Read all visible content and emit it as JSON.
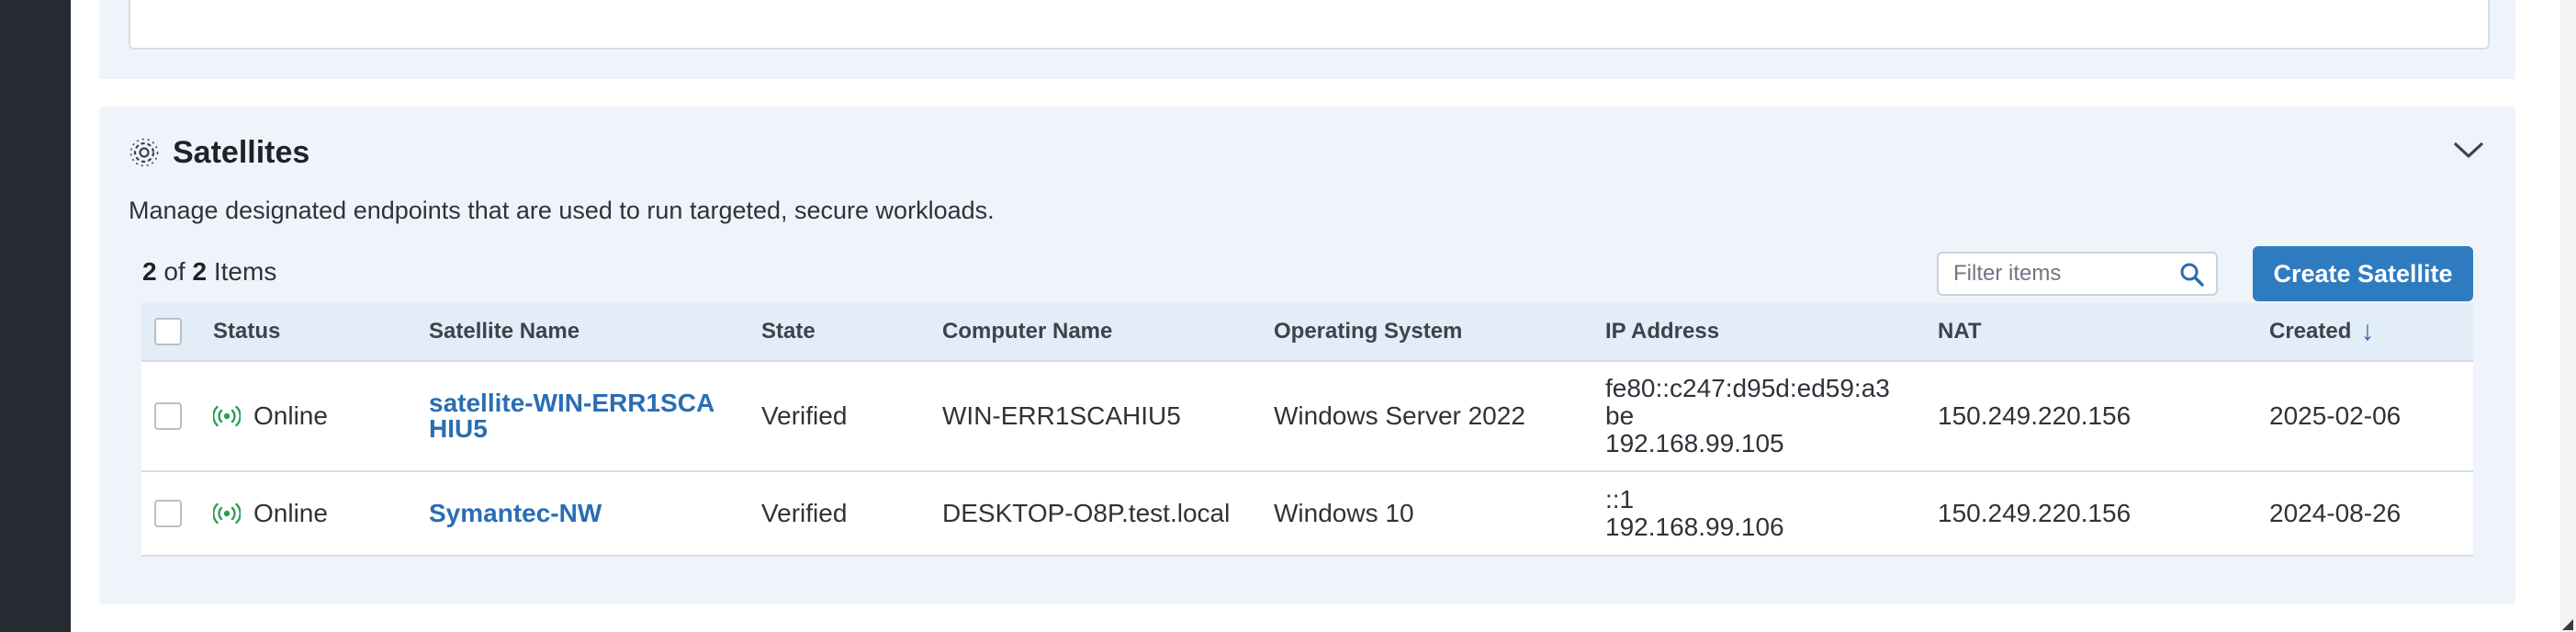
{
  "panel": {
    "title": "Satellites",
    "description": "Manage designated endpoints that are used to run targeted, secure workloads."
  },
  "toolbar": {
    "count_shown": "2",
    "count_of": "of",
    "count_total": "2",
    "count_unit": "Items",
    "filter_placeholder": "Filter items",
    "create_label": "Create Satellite"
  },
  "table": {
    "headers": {
      "status": "Status",
      "name": "Satellite Name",
      "state": "State",
      "computer": "Computer Name",
      "os": "Operating System",
      "ip": "IP Address",
      "nat": "NAT",
      "created": "Created"
    },
    "sort_indicator": "↓",
    "rows": [
      {
        "status": "Online",
        "name_line1": "satellite-WIN-ERR1SCA",
        "name_line2": "HIU5",
        "state": "Verified",
        "computer": "WIN-ERR1SCAHIU5",
        "os": "Windows Server 2022",
        "ip_line1": "fe80::c247:d95d:ed59:a3",
        "ip_line2": "be",
        "ip_line3": "192.168.99.105",
        "nat": "150.249.220.156",
        "created": "2025-02-06"
      },
      {
        "status": "Online",
        "name_line1": "Symantec-NW",
        "state": "Verified",
        "computer": "DESKTOP-O8P.test.local",
        "os": "Windows 10",
        "ip_line1": "::1",
        "ip_line2": "192.168.99.106",
        "nat": "150.249.220.156",
        "created": "2024-08-26"
      }
    ]
  },
  "icons": {
    "panel": "satellite-gear-icon",
    "collapse": "chevron-down-icon",
    "search": "search-icon",
    "status": "broadcast-online-icon"
  },
  "colors": {
    "accent": "#2f7bc0",
    "link": "#2a6db3",
    "online": "#2e9d56",
    "panel_bg": "#eef4fa",
    "header_bg": "#e3edf7",
    "sidebar": "#262b31"
  }
}
